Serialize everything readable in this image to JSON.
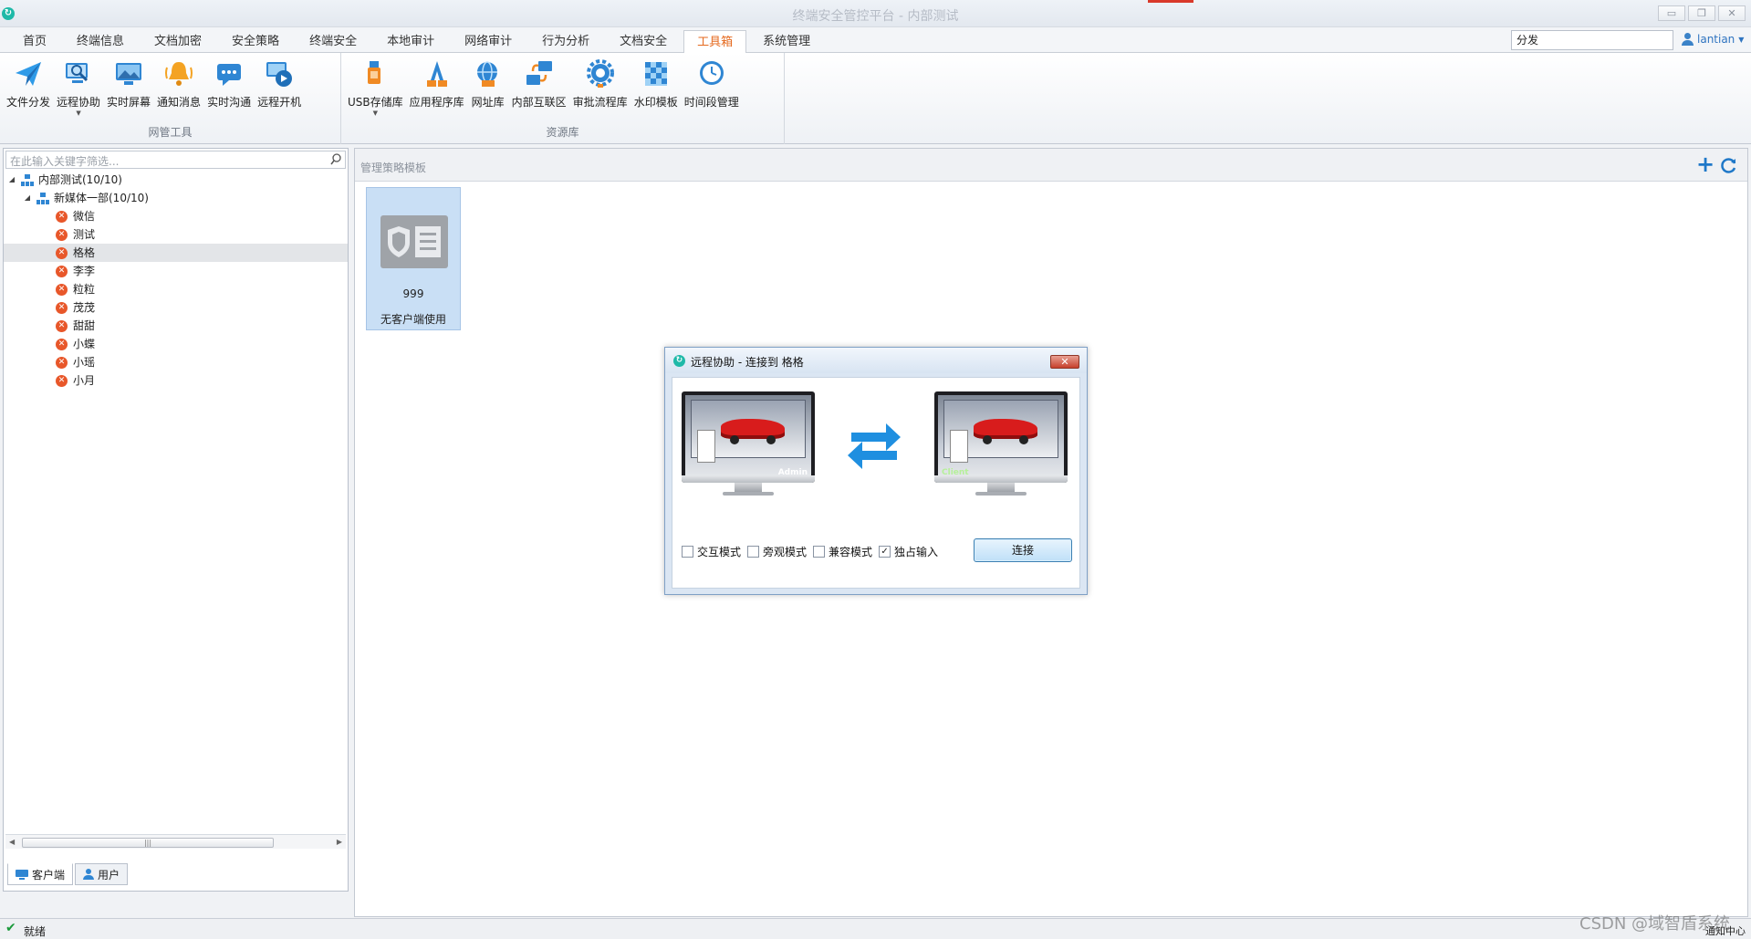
{
  "window": {
    "title": "终端安全管控平台 - 内部测试",
    "buttons": [
      "▭",
      "❐",
      "✕"
    ]
  },
  "menu": {
    "tabs": [
      "首页",
      "终端信息",
      "文档加密",
      "安全策略",
      "终端安全",
      "本地审计",
      "网络审计",
      "行为分析",
      "文档安全",
      "工具箱",
      "系统管理"
    ],
    "active_tab": "工具箱",
    "search_value": "分发",
    "user": "lantian"
  },
  "ribbon": {
    "group1_label": "网管工具",
    "group1_items": [
      "文件分发",
      "远程协助",
      "实时屏幕",
      "通知消息",
      "实时沟通",
      "远程开机"
    ],
    "group2_label": "资源库",
    "group2_items": [
      "USB存储库",
      "应用程序库",
      "网址库",
      "内部互联区",
      "审批流程库",
      "水印模板",
      "时间段管理"
    ]
  },
  "left_panel": {
    "filter_placeholder": "在此输入关键字筛选...",
    "root": "内部测试(10/10)",
    "dept": "新媒体一部(10/10)",
    "clients": [
      "微信",
      "测试",
      "格格",
      "李李",
      "粒粒",
      "茂茂",
      "甜甜",
      "小蝶",
      "小瑶",
      "小月"
    ],
    "selected_client": "格格",
    "tab_clients": "客户端",
    "tab_users": "用户"
  },
  "main": {
    "title": "管理策略模板",
    "template": {
      "id": "999",
      "name": "无客户端使用"
    }
  },
  "dialog": {
    "title": "远程协助 - 连接到 格格",
    "admin_caption": "Admin",
    "client_caption": "Client",
    "options": [
      {
        "label": "交互模式",
        "checked": false
      },
      {
        "label": "旁观模式",
        "checked": false
      },
      {
        "label": "兼容模式",
        "checked": false
      },
      {
        "label": "独占输入",
        "checked": true
      }
    ],
    "connect_label": "连接"
  },
  "status": {
    "text": "就绪",
    "right": "通知中心"
  },
  "watermark": "CSDN @域智盾系统",
  "colors": {
    "active_tab": "#e56a1f",
    "accent_blue": "#2f86d3",
    "offline_status": "#e8572a",
    "selected_template": "#c9dff5"
  }
}
